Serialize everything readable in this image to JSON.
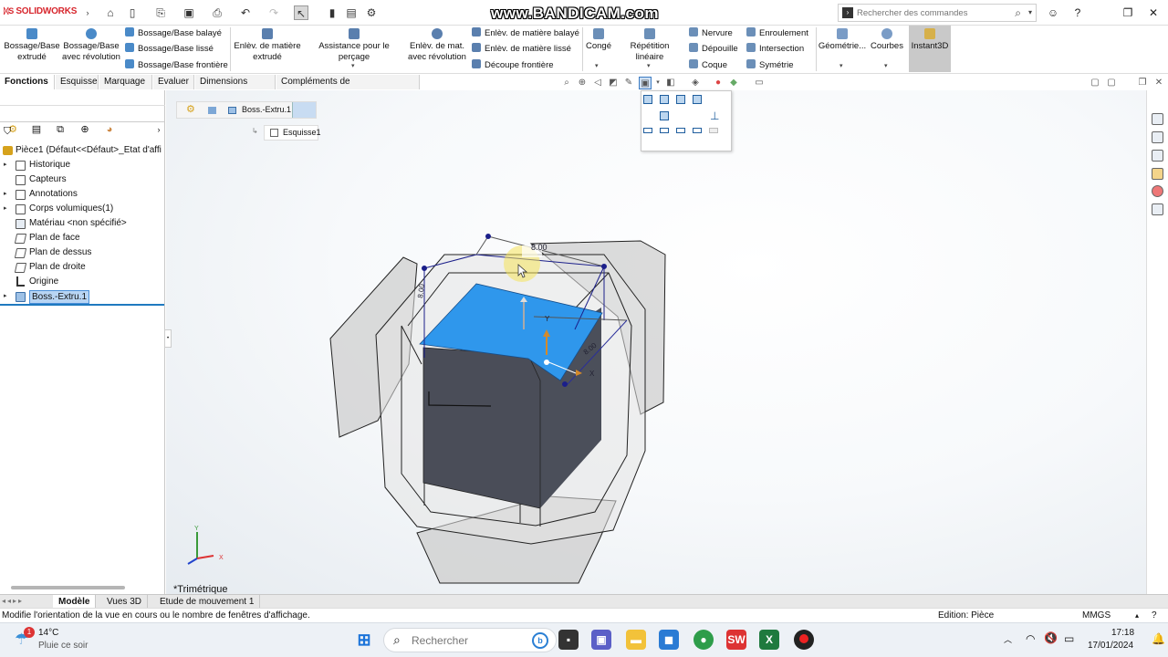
{
  "app": {
    "logo": "SOLIDWORKS",
    "watermark": "www.BANDICAM.com",
    "command_search_placeholder": "Rechercher des commandes"
  },
  "ribbon": {
    "bossage_extrude": "Bossage/Base extrudé",
    "bossage_revolution": "Bossage/Base avec révolution",
    "bossage_balaye": "Bossage/Base balayé",
    "bossage_lisse": "Bossage/Base lissé",
    "bossage_frontiere": "Bossage/Base frontière",
    "enlev_extrude": "Enlèv. de matière extrudé",
    "assistance_percage": "Assistance pour le perçage",
    "enlev_revolution": "Enlèv. de mat. avec révolution",
    "enlev_balaye": "Enlèv. de matière balayé",
    "enlev_lisse": "Enlèv. de matière lissé",
    "decoupe_frontiere": "Découpe frontière",
    "conge": "Congé",
    "repetition_lineaire": "Répétition linéaire",
    "nervure": "Nervure",
    "depouille": "Dépouille",
    "coque": "Coque",
    "enroulement": "Enroulement",
    "intersection": "Intersection",
    "symetrie": "Symétrie",
    "geometrie": "Géométrie...",
    "courbes": "Courbes",
    "instant3d": "Instant3D"
  },
  "tabs": [
    "Fonctions",
    "Esquisse",
    "Marquage",
    "Evaluer",
    "Dimensions MBD",
    "Compléments de SOLIDWORKS"
  ],
  "tree": {
    "root": "Pièce1  (Défaut<<Défaut>_Etat d'affi",
    "items": [
      "Historique",
      "Capteurs",
      "Annotations",
      "Corps volumiques(1)",
      "Matériau <non spécifié>",
      "Plan de face",
      "Plan de dessus",
      "Plan de droite",
      "Origine",
      "Boss.-Extru.1"
    ]
  },
  "breadcrumb": {
    "feature": "Boss.-Extru.1",
    "sketch": "Esquisse1"
  },
  "viewport": {
    "view_name": "*Trimétrique",
    "dim_top": "8.00",
    "dim_left": "8.00",
    "dim_right": "8.00",
    "axis_y": "Y",
    "axis_x": "X"
  },
  "bottom_tabs": [
    "Modèle",
    "Vues 3D",
    "Etude de mouvement 1"
  ],
  "status": {
    "message": "Modifie l'orientation de la vue en cours ou le nombre de fenêtres d'affichage.",
    "edition": "Edition: Pièce",
    "units": "MMGS"
  },
  "taskbar": {
    "temperature": "14°C",
    "weather": "Pluie ce soir",
    "weather_badge": "1",
    "search_placeholder": "Rechercher",
    "time": "17:18",
    "date": "17/01/2024"
  },
  "colors": {
    "selected_face": "#2f97ec",
    "body_dark": "#4b4f5a",
    "accent_red": "#d7262d"
  }
}
